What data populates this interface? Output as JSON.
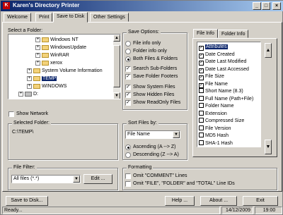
{
  "title_bar": {
    "icon": "K",
    "title": "Karen's Directory Printer",
    "minimize": "_",
    "maximize": "□",
    "close": "×"
  },
  "tabs": [
    "Welcome",
    "Print",
    "Save to Disk",
    "Other Settings"
  ],
  "select_folder": {
    "label": "Select a Folder:",
    "items": [
      {
        "name": "Windows NT",
        "expander": "+"
      },
      {
        "name": "WindowsUpdate",
        "expander": "+"
      },
      {
        "name": "WinRAR",
        "expander": "+"
      },
      {
        "name": "xerox",
        "expander": "+"
      },
      {
        "name": "System Volume Information",
        "expander": "+"
      },
      {
        "name": "TEMP",
        "expander": "+",
        "selected": true
      },
      {
        "name": "WINDOWS",
        "expander": "+"
      },
      {
        "name": "D:",
        "expander": "+"
      }
    ]
  },
  "show_network": {
    "label": "Show Network",
    "checked": false
  },
  "save_options": {
    "title": "Save Options:",
    "radios": [
      {
        "label": "File info only",
        "on": false
      },
      {
        "label": "Folder info only",
        "on": false
      },
      {
        "label": "Both Files & Folders",
        "on": true
      }
    ],
    "checks_a": [
      {
        "label": "Search Sub-Folders",
        "checked": true
      },
      {
        "label": "Save Folder Footers",
        "checked": true
      }
    ],
    "checks_b": [
      {
        "label": "Show System Files",
        "checked": true
      },
      {
        "label": "Show Hidden Files",
        "checked": true
      },
      {
        "label": "Show ReadOnly Files",
        "checked": true
      }
    ]
  },
  "selected_folder": {
    "title": "Selected Folder:",
    "value": "C:\\TEMP\\"
  },
  "sort_files": {
    "title": "Sort Files by:",
    "selected": "File Name",
    "radios": [
      {
        "label": "Ascending (A --> Z)",
        "on": true
      },
      {
        "label": "Descending (Z --> A)",
        "on": false
      }
    ]
  },
  "file_filter": {
    "title": "File Filter:",
    "selected": "All files (*.*)",
    "edit_button": "Edit ..."
  },
  "formatting": {
    "title": "Formatting",
    "checks": [
      {
        "label": "Omit \"COMMENT\" Lines",
        "checked": false
      },
      {
        "label": "Omit \"FILE\", \"FOLDER\" and \"TOTAL\" Line IDs",
        "checked": false
      }
    ]
  },
  "info_tabs": [
    "File Info",
    "Folder Info"
  ],
  "file_info_fields": [
    {
      "label": "Attributes",
      "checked": true,
      "selected": true
    },
    {
      "label": "Date Created",
      "checked": true
    },
    {
      "label": "Date Last Modified",
      "checked": true
    },
    {
      "label": "Date Last Accessed",
      "checked": true
    },
    {
      "label": "File Size",
      "checked": true
    },
    {
      "label": "File Name",
      "checked": true
    },
    {
      "label": "Short Name (8.3)",
      "checked": false
    },
    {
      "label": "Full Name (Path+File)",
      "checked": false
    },
    {
      "label": "Folder Name",
      "checked": false
    },
    {
      "label": "Extension",
      "checked": false
    },
    {
      "label": "Compressed Size",
      "checked": false
    },
    {
      "label": "File Version",
      "checked": false
    },
    {
      "label": "MD5 Hash",
      "checked": false
    },
    {
      "label": "SHA-1 Hash",
      "checked": false
    }
  ],
  "move_up": "▲",
  "move_down": "▼",
  "buttons": {
    "save": "Save to Disk...",
    "help": "Help ...",
    "about": "About ...",
    "exit": "Exit"
  },
  "status_bar": {
    "state": "Ready...",
    "date": "14/12/2009",
    "time": "19:00"
  }
}
